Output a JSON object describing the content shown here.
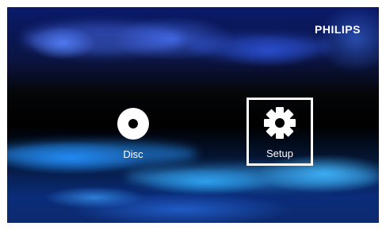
{
  "brand": {
    "logo_text": "PHILIPS"
  },
  "menu": {
    "items": [
      {
        "label": "Disc",
        "icon": "disc-icon",
        "selected": false
      },
      {
        "label": "Setup",
        "icon": "gear-icon",
        "selected": true
      }
    ]
  },
  "colors": {
    "text": "#ffffff",
    "selection_border": "#ffffff",
    "background_dark": "#000000",
    "background_accent": "#2a8cff"
  }
}
